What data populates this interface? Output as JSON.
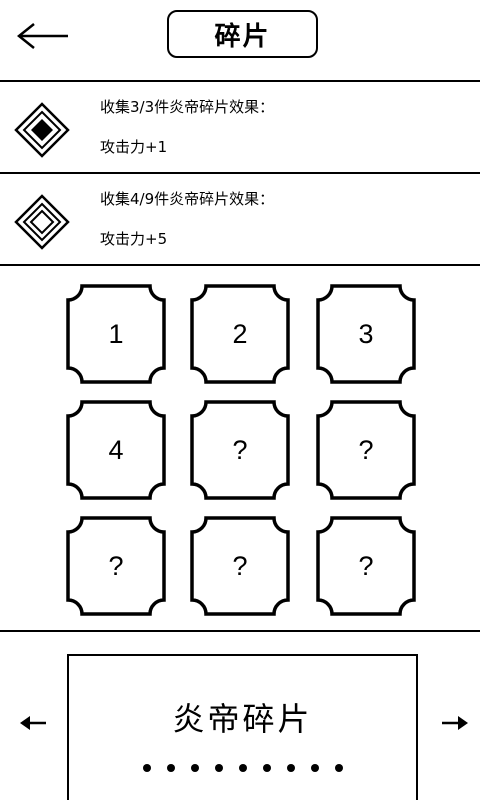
{
  "header": {
    "title": "碎片",
    "back_icon": "arrow-left-icon"
  },
  "effects": [
    {
      "icon": "diamond-filled-icon",
      "title": "收集3/3件炎帝碎片效果：",
      "value": "攻击力+1"
    },
    {
      "icon": "diamond-outline-icon",
      "title": "收集4/9件炎帝碎片效果：",
      "value": "攻击力+5"
    }
  ],
  "fragments": [
    "1",
    "2",
    "3",
    "4",
    "?",
    "?",
    "?",
    "?",
    "?"
  ],
  "set_card": {
    "title": "炎帝碎片",
    "page_dots": 9,
    "prev_icon": "arrow-left-small-icon",
    "next_icon": "arrow-right-small-icon"
  },
  "colors": {
    "line": "#000000",
    "background": "#ffffff"
  }
}
